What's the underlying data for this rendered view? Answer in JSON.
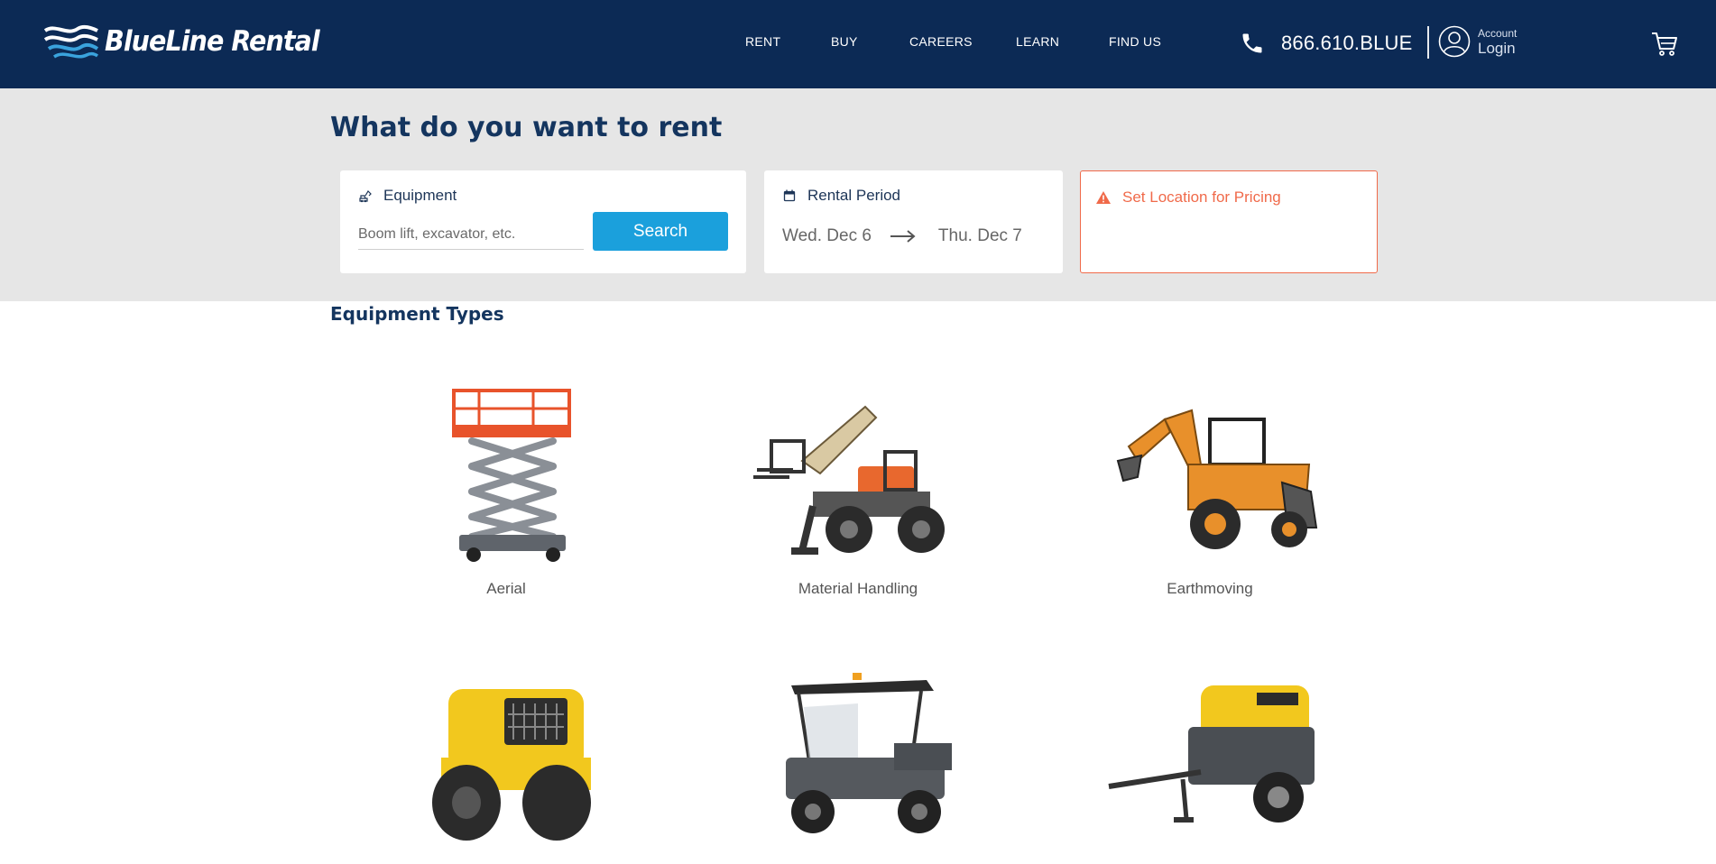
{
  "header": {
    "logo_text": "BlueLine Rental",
    "nav": [
      {
        "label": "RENT"
      },
      {
        "label": "BUY"
      },
      {
        "label": "CAREERS"
      },
      {
        "label": "LEARN"
      },
      {
        "label": "FIND US"
      }
    ],
    "phone": "866.610.BLUE",
    "account_small": "Account",
    "account_login": "Login",
    "icons": {
      "phone": "phone-icon",
      "account": "user-circle-icon",
      "cart": "cart-icon"
    }
  },
  "search": {
    "title": "What do you want to rent",
    "equipment_label": "Equipment",
    "equipment_placeholder": "Boom lift, excavator, etc.",
    "search_button": "Search",
    "rental_label": "Rental Period",
    "start_date": "Wed. Dec 6",
    "end_date": "Thu. Dec 7",
    "location_label": "Set Location for Pricing"
  },
  "types": {
    "title": "Equipment Types",
    "items": [
      {
        "label": "Aerial",
        "icon": "scissor-lift-image"
      },
      {
        "label": "Material Handling",
        "icon": "telehandler-image"
      },
      {
        "label": "Earthmoving",
        "icon": "backhoe-image"
      },
      {
        "label": "",
        "icon": "trench-roller-image"
      },
      {
        "label": "",
        "icon": "utility-vehicle-image"
      },
      {
        "label": "",
        "icon": "air-compressor-image"
      }
    ]
  },
  "colors": {
    "header_bg": "#0c2a55",
    "band_bg": "#e6e6e6",
    "accent_blue": "#1ba0dc",
    "warning": "#f06a4a",
    "title": "#14355f"
  }
}
